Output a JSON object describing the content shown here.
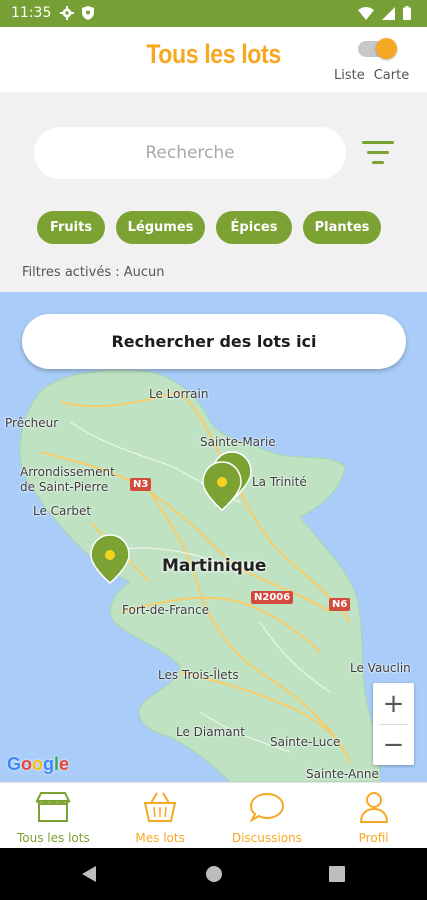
{
  "status_bar": {
    "time": "11:35"
  },
  "header": {
    "title": "Tous les lots",
    "toggle": {
      "left_label": "Liste",
      "right_label": "Carte",
      "selected": "Carte"
    }
  },
  "search": {
    "placeholder": "Recherche"
  },
  "categories": [
    "Fruits",
    "Légumes",
    "Épices",
    "Plantes"
  ],
  "filters_text": "Filtres activés : Aucun",
  "map": {
    "search_here_label": "Rechercher des lots ici",
    "region_label": "Martinique",
    "places": [
      "Le Lorrain",
      "Prêcheur",
      "Sainte-Marie",
      "Arrondissement de Saint-Pierre",
      "La Trinité",
      "Le Carbet",
      "Fort-de-France",
      "Le Vauclin",
      "Les Trois-Îlets",
      "Le Diamant",
      "Sainte-Luce",
      "Sainte-Anne"
    ],
    "road_shields": [
      "N3",
      "N2006",
      "N6"
    ],
    "zoom_in": "+",
    "zoom_out": "−",
    "attribution": "Google",
    "marker_count": 3
  },
  "bottom_nav": [
    {
      "label": "Tous les lots",
      "icon": "market-stall-icon",
      "active": true
    },
    {
      "label": "Mes lots",
      "icon": "basket-icon",
      "active": false
    },
    {
      "label": "Discussions",
      "icon": "chat-bubble-icon",
      "active": false
    },
    {
      "label": "Profil",
      "icon": "person-icon",
      "active": false
    }
  ],
  "colors": {
    "primary_green": "#7ba232",
    "accent_orange": "#f7a823",
    "status_bar": "#76a035",
    "map_water": "#a9cdf8",
    "map_land": "#bfe2c3"
  }
}
